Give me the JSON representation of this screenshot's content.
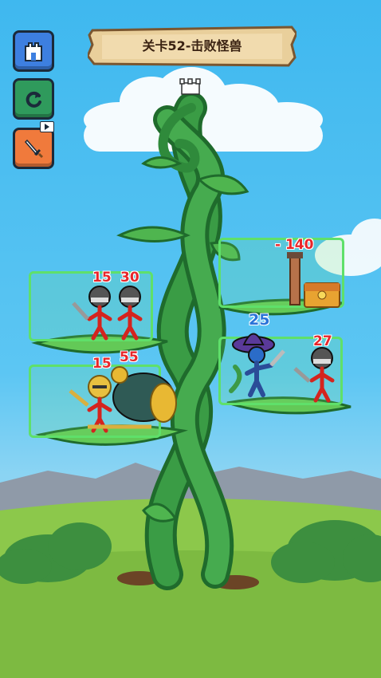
{
  "level": {
    "title": "关卡52-击败怪兽"
  },
  "sidebar": {
    "icons": [
      "castle-icon",
      "restart-icon",
      "sword-icon"
    ],
    "video_badge": "video-icon"
  },
  "rooms": {
    "left_top": {
      "enemies": [
        "15",
        "30"
      ]
    },
    "left_bottom": {
      "enemies": [
        "15",
        "55"
      ]
    },
    "right_top": {
      "reward": "- 140"
    },
    "right_bottom": {
      "hero": "25",
      "enemy": "27"
    }
  },
  "colors": {
    "sky": "#3fb8ef",
    "grass": "#8cc84b",
    "vine": "#2e8f3a",
    "room_border": "#5fe06a",
    "enemy_power": "#e8262b",
    "hero_power": "#2b74d8"
  }
}
